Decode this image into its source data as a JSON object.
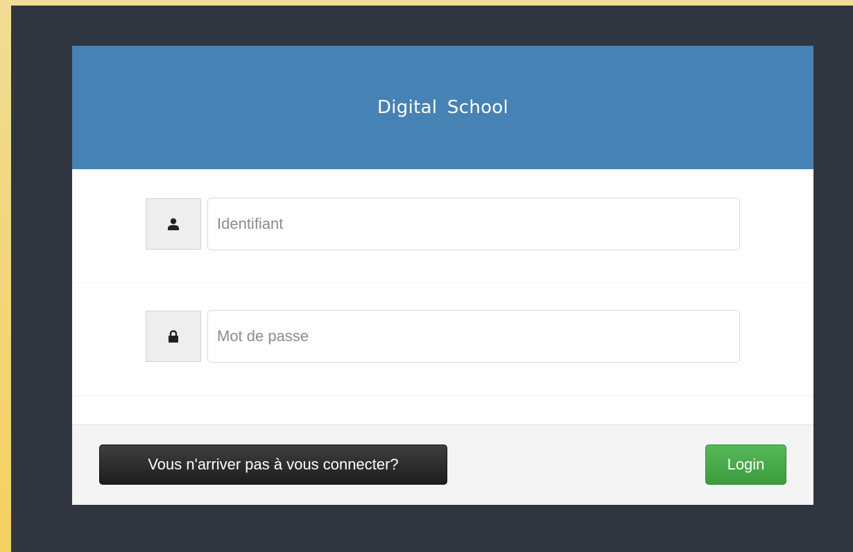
{
  "header": {
    "title": "Digital  School"
  },
  "form": {
    "username": {
      "icon": "user-icon",
      "value": "",
      "placeholder": "Identifiant"
    },
    "password": {
      "icon": "lock-icon",
      "value": "",
      "placeholder": "Mot de passe"
    }
  },
  "footer": {
    "help_label": "Vous n'arriver pas à vous connecter?",
    "login_label": "Login"
  },
  "colors": {
    "header": "#4682b4",
    "page_background": "#2f3640",
    "login_button": "#4cae4c",
    "help_button": "#2b2b2b"
  }
}
